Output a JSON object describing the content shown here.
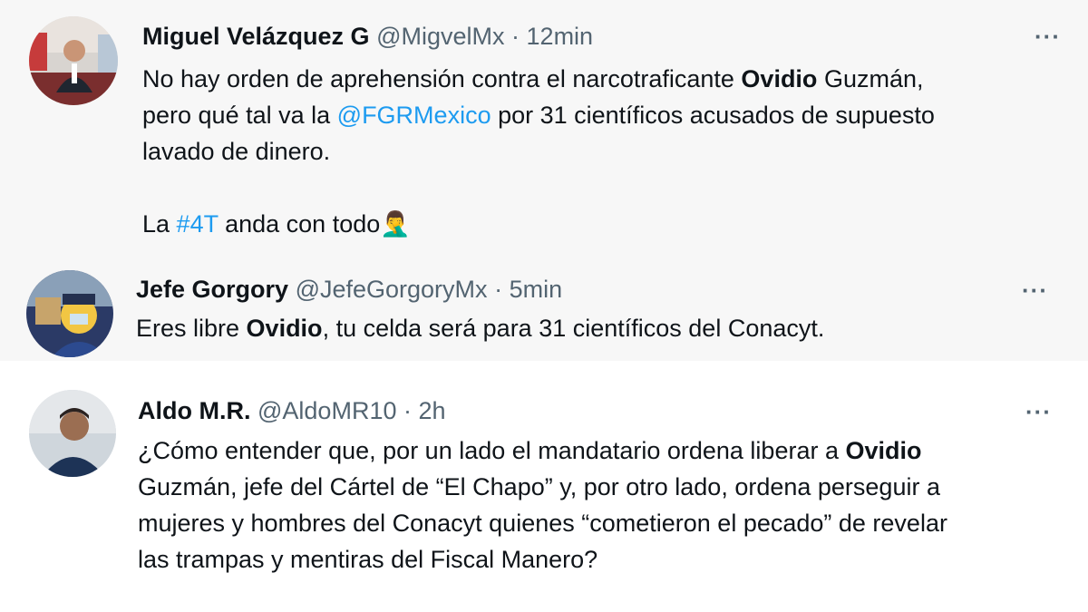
{
  "tweets": [
    {
      "name": "Miguel Velázquez G",
      "handle": "@MigvelMx",
      "sep": "·",
      "time": "12min",
      "more": "···",
      "text": {
        "l1_a": "No hay orden de aprehensión contra el narcotraficante ",
        "l1_bold": "Ovidio",
        "l1_b": " Guzmán,",
        "l2_a": "pero qué tal va la ",
        "l2_link": "@FGRMexico",
        "l2_b": " por 31 científicos acusados de supuesto",
        "l3": "lavado de dinero.",
        "l4_a": "La ",
        "l4_link": "#4T",
        "l4_b": " anda con todo",
        "emoji": "🤦‍♂️"
      }
    },
    {
      "name": "Jefe Gorgory",
      "handle": "@JefeGorgoryMx",
      "sep": "·",
      "time": "5min",
      "more": "···",
      "text": {
        "l1_a": "Eres libre ",
        "l1_bold": "Ovidio",
        "l1_b": ", tu celda será para 31 científicos del Conacyt."
      }
    },
    {
      "name": "Aldo M.R.",
      "handle": "@AldoMR10",
      "sep": "·",
      "time": "2h",
      "more": "···",
      "text": {
        "l1_a": "¿Cómo entender que, por un lado el mandatario ordena liberar a ",
        "l1_bold": "Ovidio",
        "l2": "Guzmán, jefe del Cártel de “El Chapo” y, por otro lado, ordena perseguir a",
        "l3": "mujeres y hombres del Conacyt quienes “cometieron el pecado” de revelar",
        "l4": "las trampas y mentiras del Fiscal Manero?"
      }
    }
  ],
  "colors": {
    "link": "#1d9bf0",
    "meta": "#536471",
    "text": "#0f1419",
    "bg_gray": "#f7f7f7"
  }
}
